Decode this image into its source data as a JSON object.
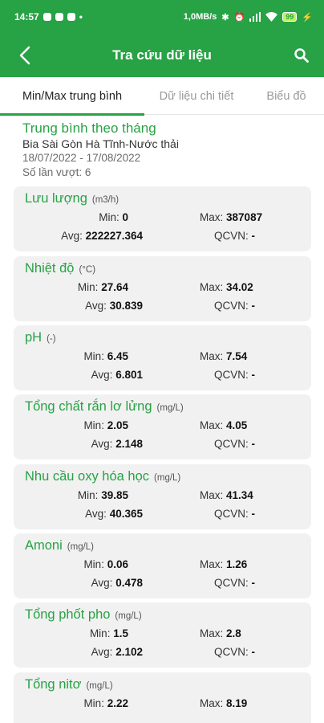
{
  "status": {
    "time": "14:57",
    "speed": "1,0MB/s",
    "battery": "99"
  },
  "header": {
    "title": "Tra cứu dữ liệu"
  },
  "tabs": [
    {
      "label": "Min/Max trung bình"
    },
    {
      "label": "Dữ liệu chi tiết"
    },
    {
      "label": "Biểu đồ"
    }
  ],
  "summary": {
    "heading": "Trung bình theo tháng",
    "station": "Bia Sài Gòn Hà Tĩnh-Nước thải",
    "period": "18/07/2022 - 17/08/2022",
    "exceed": "Số lần vượt: 6"
  },
  "labels": {
    "min": "Min:",
    "max": "Max:",
    "avg": "Avg:",
    "qcvn": "QCVN:"
  },
  "params": [
    {
      "name": "Lưu lượng",
      "unit": "(m3/h)",
      "min": "0",
      "max": "387087",
      "avg": "222227.364",
      "qcvn": "-"
    },
    {
      "name": "Nhiệt độ",
      "unit": "(°C)",
      "min": "27.64",
      "max": "34.02",
      "avg": "30.839",
      "qcvn": "-"
    },
    {
      "name": "pH",
      "unit": "(-)",
      "min": "6.45",
      "max": "7.54",
      "avg": "6.801",
      "qcvn": "-"
    },
    {
      "name": "Tổng chất rắn lơ lửng",
      "unit": "(mg/L)",
      "min": "2.05",
      "max": "4.05",
      "avg": "2.148",
      "qcvn": "-"
    },
    {
      "name": "Nhu cầu oxy hóa học",
      "unit": "(mg/L)",
      "min": "39.85",
      "max": "41.34",
      "avg": "40.365",
      "qcvn": "-"
    },
    {
      "name": "Amoni",
      "unit": "(mg/L)",
      "min": "0.06",
      "max": "1.26",
      "avg": "0.478",
      "qcvn": "-"
    },
    {
      "name": "Tổng phốt pho",
      "unit": "(mg/L)",
      "min": "1.5",
      "max": "2.8",
      "avg": "2.102",
      "qcvn": "-"
    },
    {
      "name": "Tổng nitơ",
      "unit": "(mg/L)",
      "min": "2.22",
      "max": "8.19",
      "avg": "",
      "qcvn": ""
    }
  ],
  "colors": {
    "brand": "#27a245",
    "card": "#f1f1f1"
  }
}
